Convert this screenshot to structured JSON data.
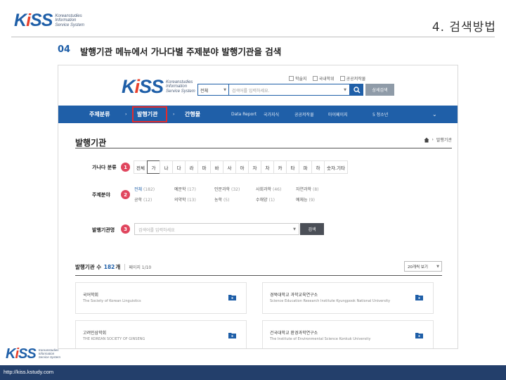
{
  "slide": {
    "title": "4. 검색방법",
    "step_number": "04",
    "step_text": "발행기관 메뉴에서 가나다별 주제분야 발행기관을 검색",
    "footer_url": "http://kiss.kstudy.com"
  },
  "logo": {
    "mark_k": "K",
    "mark_i": "i",
    "mark_ss": "SS",
    "sub_lines": [
      "Koreanstudies",
      "Information",
      "Service System"
    ]
  },
  "site": {
    "checkboxes": [
      "학술지",
      "국내학위",
      "공공저작물"
    ],
    "search_select": "전체",
    "search_placeholder": "검색어를 입력하세요.",
    "advanced_label": "상세검색",
    "nav": {
      "subject": "주제분류",
      "publisher": "발행기관",
      "publication": "간행물",
      "sub_items": [
        "Data Report",
        "국가지식",
        "공공저작물",
        "마이페이지",
        "5 청소년"
      ]
    },
    "page_title": "발행기관",
    "breadcrumb": "발행기관",
    "filter": {
      "alpha_label": "가나다 분류",
      "subject_label": "주제분야",
      "name_label": "발행기관명",
      "badges": [
        "1",
        "2",
        "3"
      ],
      "letters": [
        "전체",
        "가",
        "나",
        "다",
        "라",
        "마",
        "바",
        "사",
        "아",
        "자",
        "차",
        "카",
        "타",
        "파",
        "하",
        "숫자.기타"
      ],
      "subjects": [
        {
          "name": "전체",
          "count": "(182)"
        },
        {
          "name": "예문학",
          "count": "(17)"
        },
        {
          "name": "인문과학",
          "count": "(32)"
        },
        {
          "name": "사회과학",
          "count": "(46)"
        },
        {
          "name": "자연과학",
          "count": "(8)"
        },
        {
          "name": "공학",
          "count": "(12)"
        },
        {
          "name": "의약학",
          "count": "(13)"
        },
        {
          "name": "농학",
          "count": "(5)"
        },
        {
          "name": "수해양",
          "count": "(1)"
        },
        {
          "name": "예체능",
          "count": "(9)"
        }
      ],
      "name_placeholder": "검색어를 입력하세요",
      "name_button": "검색"
    },
    "results": {
      "count_prefix": "발행기관 수",
      "count": "182",
      "count_suffix": "개",
      "page_info": "페이지 1/10",
      "per_page": "20개씩 보기",
      "cards": [
        {
          "kname": "국어학회",
          "ename": "The Society of Korean Linguistics"
        },
        {
          "kname": "경북대학교 과학교육연구소",
          "ename": "Science Education Research Institute Kyungpook National University"
        },
        {
          "kname": "고려인삼학회",
          "ename": "THE KOREAN SOCIETY OF GINSENG"
        },
        {
          "kname": "건국대학교 환경과학연구소",
          "ename": "The Institute of Environmental Science Konkuk University"
        }
      ]
    }
  },
  "colors": {
    "brand_blue": "#1f5fa8",
    "highlight_red": "#e52b2b",
    "badge_pink": "#e0465e",
    "footer_navy": "#233f6b"
  },
  "icons": [
    "search-icon",
    "home-icon",
    "folder-icon",
    "chevron-down-icon"
  ]
}
